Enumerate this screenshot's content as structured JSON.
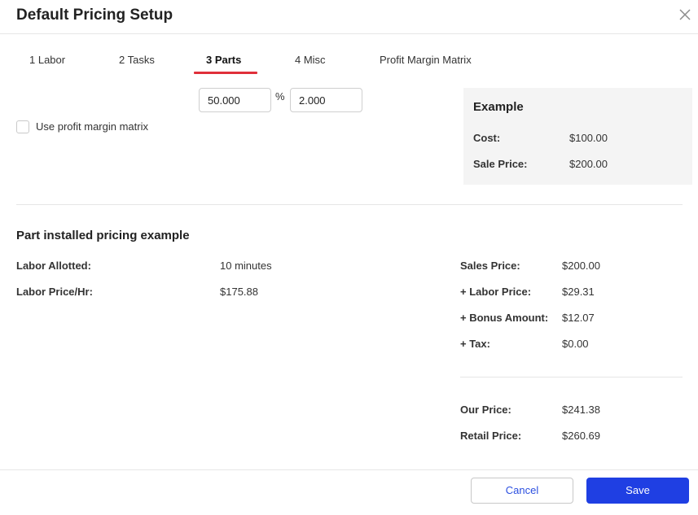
{
  "dialog": {
    "title": "Default Pricing Setup"
  },
  "tabs": [
    {
      "label": "1 Labor"
    },
    {
      "label": "2 Tasks"
    },
    {
      "label": "3 Parts",
      "active": true
    },
    {
      "label": "4 Misc"
    },
    {
      "label": "Profit Margin Matrix"
    }
  ],
  "markup": {
    "margin_value": "50.000",
    "percent_symbol": "%",
    "multiplier_value": "2.000"
  },
  "profit_matrix_checkbox": {
    "label": "Use profit margin matrix",
    "checked": false
  },
  "example": {
    "title": "Example",
    "cost_label": "Cost:",
    "cost_value": "$100.00",
    "sale_label": "Sale Price:",
    "sale_value": "$200.00"
  },
  "installed": {
    "title": "Part installed pricing example",
    "left": [
      {
        "label": "Labor Allotted:",
        "value": "10 minutes"
      },
      {
        "label": "Labor Price/Hr:",
        "value": "$175.88"
      }
    ],
    "right": [
      {
        "label": "Sales Price:",
        "value": "$200.00"
      },
      {
        "label": "+ Labor Price:",
        "value": "$29.31"
      },
      {
        "label": "+ Bonus Amount:",
        "value": "$12.07"
      },
      {
        "label": "+ Tax:",
        "value": "$0.00"
      }
    ],
    "totals": [
      {
        "label": "Our Price:",
        "value": "$241.38"
      },
      {
        "label": "Retail Price:",
        "value": "$260.69"
      }
    ]
  },
  "buttons": {
    "cancel": "Cancel",
    "save": "Save"
  },
  "colors": {
    "accent_red": "#e0303a",
    "primary_blue": "#1f3fe3"
  },
  "icons": {
    "close": "close-icon"
  }
}
